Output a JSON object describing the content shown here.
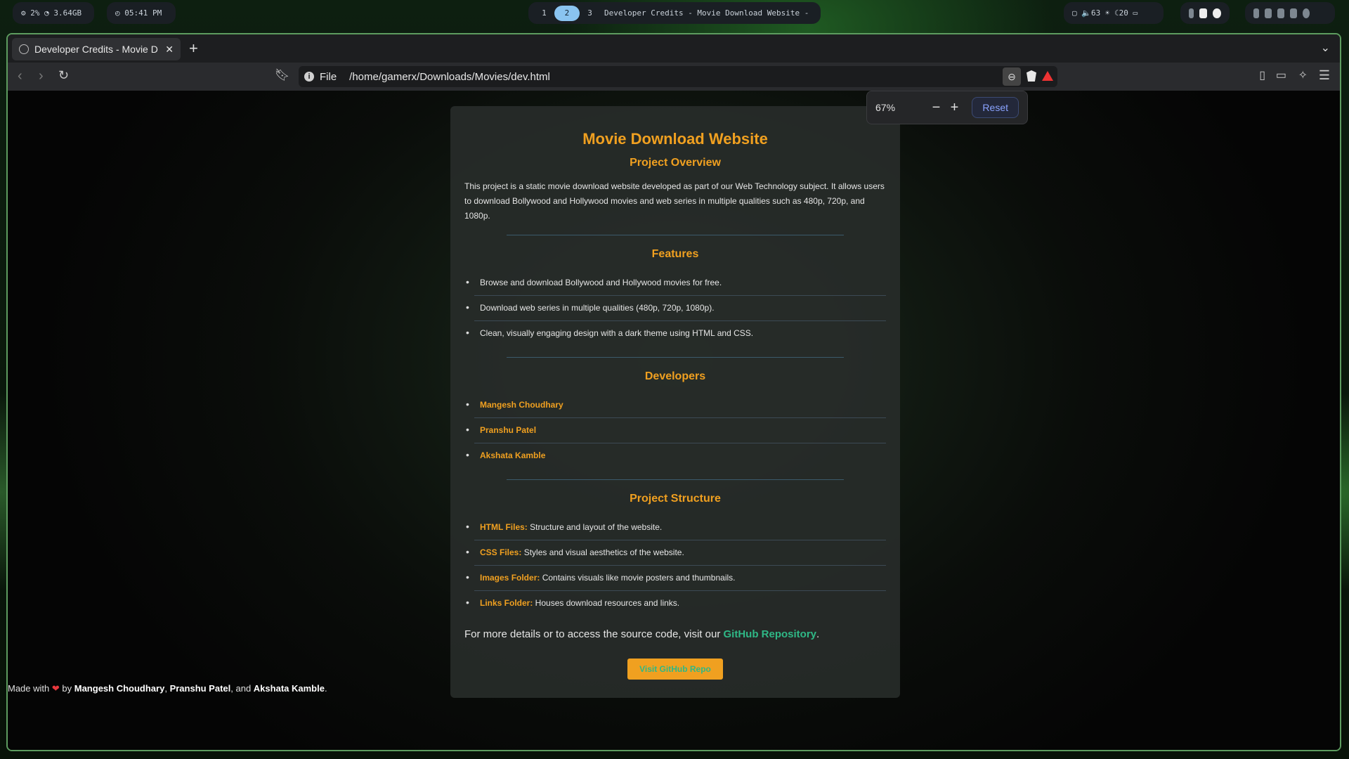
{
  "system_bar": {
    "stats": "⚙ 2%  ◔ 3.64GB",
    "clock": "◴ 05:41 PM",
    "workspaces": [
      "1",
      "2",
      "3"
    ],
    "active_workspace": "2",
    "window_title": "Developer Credits - Movie Download Website - B…",
    "tray": "▢ 🔈63  ☀ ☾20  ▭"
  },
  "browser": {
    "tab_title": "Developer Credits - Movie D",
    "url_scheme": "File",
    "url": "/home/gamerx/Downloads/Movies/dev.html",
    "zoom_popup": {
      "level": "67%",
      "minus": "−",
      "plus": "+",
      "reset": "Reset"
    }
  },
  "page": {
    "title": "Movie Download Website",
    "overview_heading": "Project Overview",
    "overview_text": "This project is a static movie download website developed as part of our Web Technology subject. It allows users to download Bollywood and Hollywood movies and web series in multiple qualities such as 480p, 720p, and 1080p.",
    "features_heading": "Features",
    "features": [
      "Browse and download Bollywood and Hollywood movies for free.",
      "Download web series in multiple qualities (480p, 720p, 1080p).",
      "Clean, visually engaging design with a dark theme using HTML and CSS."
    ],
    "developers_heading": "Developers",
    "developers": [
      "Mangesh Choudhary",
      "Pranshu Patel",
      "Akshata Kamble"
    ],
    "structure_heading": "Project Structure",
    "structure": [
      {
        "key": "HTML Files:",
        "text": " Structure and layout of the website."
      },
      {
        "key": "CSS Files:",
        "text": " Styles and visual aesthetics of the website."
      },
      {
        "key": "Images Folder:",
        "text": " Contains visuals like movie posters and thumbnails."
      },
      {
        "key": "Links Folder:",
        "text": " Houses download resources and links."
      }
    ],
    "more_prefix": "For more details or to access the source code, visit our ",
    "more_link": "GitHub Repository",
    "more_suffix": ".",
    "button": "Visit GitHub Repo",
    "footer": {
      "prefix": "Made with ",
      "heart": "❤",
      "by": " by ",
      "name1": "Mangesh Choudhary",
      "comma": ", ",
      "name2": "Pranshu Patel",
      "and": ", and ",
      "name3": "Akshata Kamble",
      "end": "."
    }
  },
  "colors": {
    "accent": "#f0a020",
    "link": "#2fb886",
    "window_border": "#5d9c5f"
  }
}
